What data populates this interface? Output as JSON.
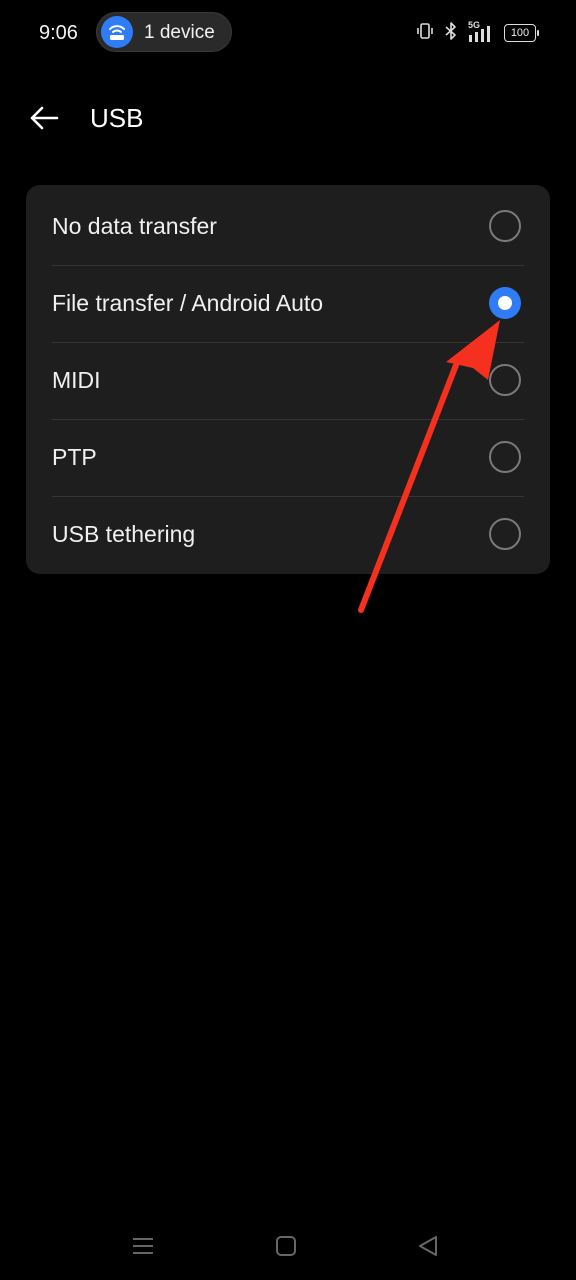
{
  "status_bar": {
    "time": "9:06",
    "hotspot_label": "1 device",
    "network": "5G",
    "battery": "100",
    "icons": [
      "vibrate-icon",
      "bluetooth-icon",
      "signal-icon",
      "battery-icon"
    ]
  },
  "header": {
    "title": "USB",
    "back_icon": "arrow-left-icon"
  },
  "usb_options": [
    {
      "label": "No data transfer",
      "selected": false
    },
    {
      "label": "File transfer / Android Auto",
      "selected": true
    },
    {
      "label": "MIDI",
      "selected": false
    },
    {
      "label": "PTP",
      "selected": false
    },
    {
      "label": "USB tethering",
      "selected": false
    }
  ],
  "colors": {
    "accent": "#2f7cf6",
    "annotation_arrow": "#f5301e",
    "card_background": "#1e1e1e"
  },
  "nav_bar": {
    "icons": [
      "recents-menu-icon",
      "home-square-icon",
      "back-triangle-icon"
    ]
  }
}
